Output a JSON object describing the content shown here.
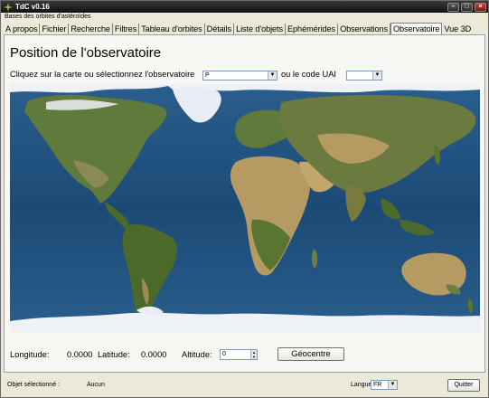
{
  "window": {
    "title": "TdC v0.16",
    "subtitle": "Bases des orbites d'astéroïdes"
  },
  "tabs": [
    {
      "label": "A propos"
    },
    {
      "label": "Fichier"
    },
    {
      "label": "Recherche"
    },
    {
      "label": "Filtres"
    },
    {
      "label": "Tableau d'orbites"
    },
    {
      "label": "Détails"
    },
    {
      "label": "Liste d'objets"
    },
    {
      "label": "Ephémérides"
    },
    {
      "label": "Observations"
    },
    {
      "label": "Observatoire",
      "active": true
    },
    {
      "label": "Vue 3D"
    }
  ],
  "panel": {
    "title": "Position de l'observatoire",
    "instruction": "Cliquez sur la carte ou sélectionnez l'observatoire",
    "observatory_select_value": "P",
    "or_code_label": "ou le code UAI",
    "code_select_value": ""
  },
  "coords": {
    "longitude_label": "Longitude:",
    "longitude_value": "0.0000",
    "latitude_label": "Latitude:",
    "latitude_value": "0.0000",
    "altitude_label": "Altitude:",
    "altitude_value": "0",
    "geocentre_label": "Géocentre"
  },
  "status": {
    "selected_label": "Objet sélectionné :",
    "selected_value": "Aucun",
    "language_label": "Langue",
    "language_value": "FR",
    "quit_label": "Quitter"
  },
  "colors": {
    "ocean": "#1f4f7a",
    "land": "#5f7a3a",
    "desert": "#b59a62",
    "ice": "#eef2f6"
  }
}
